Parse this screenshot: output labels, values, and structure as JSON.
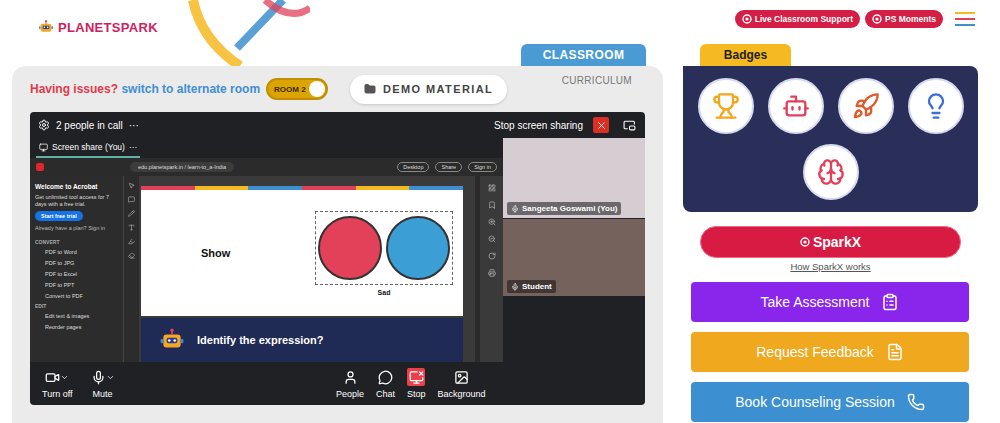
{
  "logo": {
    "text": "PLANETSPARK"
  },
  "header_buttons": [
    {
      "label": "Live Classroom Support"
    },
    {
      "label": "PS Moments"
    }
  ],
  "tabs": [
    {
      "label": "CLASSROOM",
      "selected": true
    },
    {
      "label": "CURRICULUM",
      "selected": false
    }
  ],
  "room_switch": {
    "issue": "Having issues?",
    "link": "switch to alternate room",
    "toggle": "ROOM 2",
    "on": true
  },
  "demo_button": {
    "label": "DEMO MATERIAL"
  },
  "call": {
    "header": {
      "people": "2 people in call",
      "more": "···",
      "stop_sharing": "Stop screen sharing"
    },
    "share_tab": {
      "label": "Screen share (You)",
      "more": "···",
      "selected": true
    },
    "screen": {
      "browser": {
        "address": "edu.planetspark.in / learn-to_a-India",
        "buttons": [
          "Desktop",
          "Share",
          "Sign in"
        ]
      },
      "acrobat": {
        "title": "Welcome to Acrobat",
        "body": "Get unlimited tool access for 7 days with a free trial.",
        "button": "Start free trial",
        "signin": "Already have a plan? Sign in",
        "sections": [
          {
            "heading": "CONVERT",
            "items": [
              "PDF to Word",
              "PDF to JPG",
              "PDF to Excel",
              "PDF to PPT",
              "Convert to PDF"
            ]
          },
          {
            "heading": "EDIT",
            "items": [
              "Edit text & images",
              "Reorder pages"
            ]
          }
        ]
      },
      "slide": {
        "word": "Show",
        "caption": "Sad",
        "photos": [
          {
            "color": "#e3405a"
          },
          {
            "color": "#3b9fd6"
          }
        ],
        "question": "Identify the expression?"
      }
    },
    "tiles": [
      {
        "name": "Sangeeta Goswami (You)"
      },
      {
        "name": "Student"
      }
    ],
    "media_controls": [
      {
        "label": "Turn off",
        "kind": "camera",
        "dropdown": true,
        "active": false
      },
      {
        "label": "Mute",
        "kind": "mic",
        "dropdown": true,
        "active": false
      }
    ],
    "call_controls": [
      {
        "label": "People",
        "kind": "people",
        "dropdown": false,
        "active": false
      },
      {
        "label": "Chat",
        "kind": "chat",
        "dropdown": false,
        "active": false
      },
      {
        "label": "Stop",
        "kind": "stop",
        "dropdown": false,
        "active": true
      },
      {
        "label": "Background",
        "kind": "background",
        "dropdown": false,
        "active": false
      }
    ]
  },
  "badges": {
    "title": "Badges",
    "items": [
      {
        "kind": "trophy",
        "color": "#f2a71b"
      },
      {
        "kind": "hero",
        "color": "#e2405a"
      },
      {
        "kind": "rocket",
        "color": "#e05a2a"
      },
      {
        "kind": "idea",
        "color": "#3b6fd6"
      },
      {
        "kind": "brain",
        "color": "#e2405a"
      }
    ]
  },
  "sparkx": {
    "label": "SparkX",
    "link": "How SparkX works"
  },
  "actions": [
    {
      "label": "Take Assessment",
      "kind": "assessment",
      "color": "#8a25ec"
    },
    {
      "label": "Request Feedback",
      "kind": "feedback",
      "color": "#f0a91f"
    },
    {
      "label": "Book Counseling Session",
      "kind": "call",
      "color": "#3c8fd0"
    }
  ]
}
